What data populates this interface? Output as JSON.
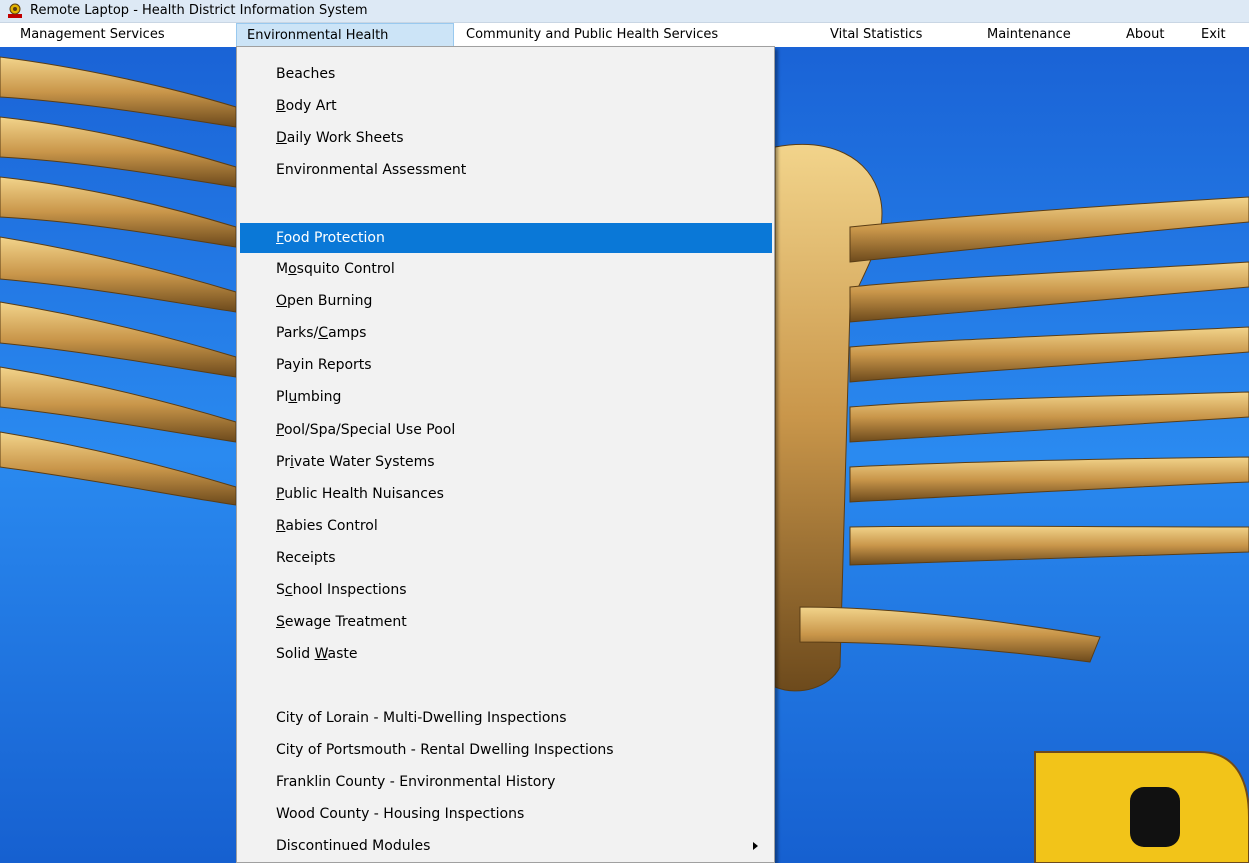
{
  "window": {
    "title": "Remote Laptop - Health District Information System",
    "icon": "app-badge-icon"
  },
  "menubar": {
    "items": [
      {
        "label": "Management Services"
      },
      {
        "label": "Environmental Health",
        "active": true
      },
      {
        "label": "Community and Public Health Services"
      },
      {
        "label": "Vital Statistics"
      },
      {
        "label": "Maintenance"
      },
      {
        "label": "About"
      },
      {
        "label": "Exit"
      }
    ]
  },
  "dropdown": {
    "items": [
      {
        "label": "Beaches",
        "mnemonic": ""
      },
      {
        "label": "Body Art",
        "mnemonic": "B"
      },
      {
        "label": "Daily Work Sheets",
        "mnemonic": "D"
      },
      {
        "label": "Environmental Assessment",
        "mnemonic": ""
      },
      {
        "label": "Food Protection",
        "mnemonic": "F",
        "selected": true
      },
      {
        "label": "Mosquito Control",
        "mnemonic": "o"
      },
      {
        "label": "Open Burning",
        "mnemonic": "O"
      },
      {
        "label": "Parks/Camps",
        "mnemonic": "C"
      },
      {
        "label": "Payin Reports",
        "mnemonic": ""
      },
      {
        "label": "Plumbing",
        "mnemonic": "u"
      },
      {
        "label": "Pool/Spa/Special Use Pool",
        "mnemonic": "P"
      },
      {
        "label": "Private Water Systems",
        "mnemonic": "i"
      },
      {
        "label": "Public Health Nuisances",
        "mnemonic": "P"
      },
      {
        "label": "Rabies Control",
        "mnemonic": "R"
      },
      {
        "label": "Receipts",
        "mnemonic": ""
      },
      {
        "label": "School Inspections",
        "mnemonic": "c"
      },
      {
        "label": "Sewage Treatment",
        "mnemonic": "S"
      },
      {
        "label": "Solid Waste",
        "mnemonic": "W"
      },
      {
        "label": "City of Lorain - Multi-Dwelling Inspections",
        "mnemonic": ""
      },
      {
        "label": "City of Portsmouth - Rental Dwelling Inspections",
        "mnemonic": ""
      },
      {
        "label": "Franklin County - Environmental History",
        "mnemonic": ""
      },
      {
        "label": "Wood County - Housing Inspections",
        "mnemonic": ""
      },
      {
        "label": "Discontinued Modules",
        "mnemonic": "",
        "submenu": true
      }
    ]
  },
  "colors": {
    "selection": "#0a78d7",
    "menu_active_bg": "#cce4f7",
    "background_blue": "#1b74e0",
    "background_gold": "#d8b261"
  }
}
